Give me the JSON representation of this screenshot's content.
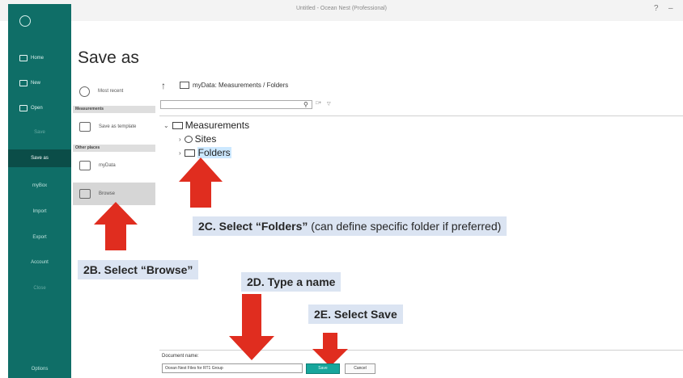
{
  "window": {
    "title": "Untitled - Ocean Nest (Professional)",
    "controls": [
      "?",
      "–"
    ]
  },
  "sidebar": {
    "items": [
      {
        "label": "Home",
        "icon": "home-icon"
      },
      {
        "label": "New",
        "icon": "new-document-icon"
      },
      {
        "label": "Open",
        "icon": "open-folder-icon"
      },
      {
        "label": "Save"
      },
      {
        "label": "Save as"
      },
      {
        "label": "myBox"
      },
      {
        "label": "Import"
      },
      {
        "label": "Export"
      },
      {
        "label": "Account"
      },
      {
        "label": "Close"
      },
      {
        "label": "Options"
      }
    ]
  },
  "page": {
    "heading": "Save as"
  },
  "locations": {
    "recent": "Most recent",
    "section_measurements": "Measurements",
    "save_as_template": "Save as template",
    "section_other": "Other places",
    "mydata": "myData",
    "browse": "Browse"
  },
  "browser": {
    "path": "myData: Measurements / Folders",
    "search_placeholder": "",
    "search_icon": "search-icon",
    "tree": {
      "root": "Measurements",
      "children": [
        "Sites",
        "Folders"
      ]
    }
  },
  "callouts": {
    "browse": "2B. Select “Browse”",
    "folders_bold": "2C. Select “Folders”",
    "folders_note": " (can define specific folder if preferred)",
    "name": "2D. Type a name",
    "save": "2E. Select Save"
  },
  "form": {
    "doc_label": "Document name:",
    "doc_value": "Ocean Nest Files for RT1 Group",
    "save_label": "Save",
    "cancel_label": "Cancel"
  },
  "colors": {
    "rail": "#0f6e67",
    "rail_selected": "#0b4d48",
    "arrow": "#e02d1f",
    "callout_bg": "#dbe4f2",
    "save_button": "#17a69c"
  }
}
